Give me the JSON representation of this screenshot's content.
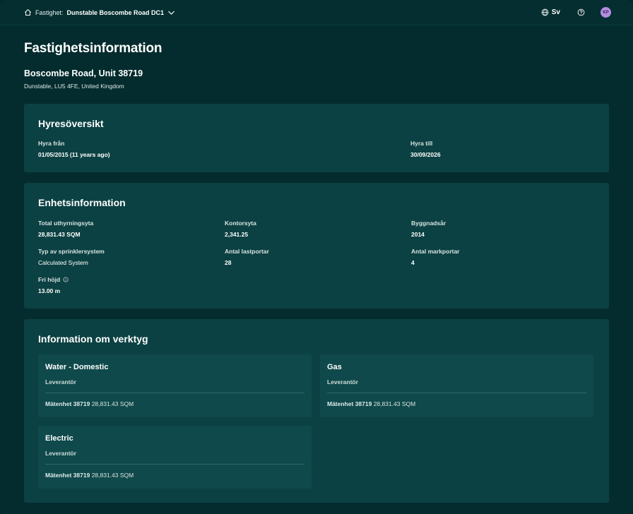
{
  "topbar": {
    "property_label": "Fastighet:",
    "property_value": "Dunstable Boscombe Road DC1",
    "language": "Sv",
    "avatar_initials": "KP"
  },
  "header": {
    "title": "Fastighetsinformation",
    "property_name": "Boscombe Road, Unit 38719",
    "address": "Dunstable, LU5 4FE, United Kingdom"
  },
  "lease": {
    "title": "Hyresöversikt",
    "from_label": "Hyra från",
    "from_value": "01/05/2015 (11 years ago)",
    "to_label": "Hyra till",
    "to_value": "30/09/2026"
  },
  "unit": {
    "title": "Enhetsinformation",
    "fields": [
      {
        "label": "Total uthyrningsyta",
        "value": "28,831.43 SQM"
      },
      {
        "label": "Kontorsyta",
        "value": "2,341.25"
      },
      {
        "label": "Byggnadsår",
        "value": "2014"
      },
      {
        "label": "Typ av sprinklersystem",
        "value": "Calculated System"
      },
      {
        "label": "Antal lastportar",
        "value": "28"
      },
      {
        "label": "Antal markportar",
        "value": "4"
      },
      {
        "label": "Fri höjd",
        "value": "13.00 m"
      }
    ]
  },
  "utilities": {
    "title": "Information om verktyg",
    "items": [
      {
        "name": "Water - Domestic",
        "supplier_label": "Leverantör",
        "meter_label": "Mätenhet 38719",
        "meter_value": "28,831.43 SQM"
      },
      {
        "name": "Gas",
        "supplier_label": "Leverantör",
        "meter_label": "Mätenhet 38719",
        "meter_value": "28,831.43 SQM"
      },
      {
        "name": "Electric",
        "supplier_label": "Leverantör",
        "meter_label": "Mätenhet 38719",
        "meter_value": "28,831.43 SQM"
      }
    ]
  },
  "colors": {
    "background": "#042c2e",
    "card": "#0c4143",
    "utility_card": "#0f494b",
    "avatar": "#b48de0"
  }
}
